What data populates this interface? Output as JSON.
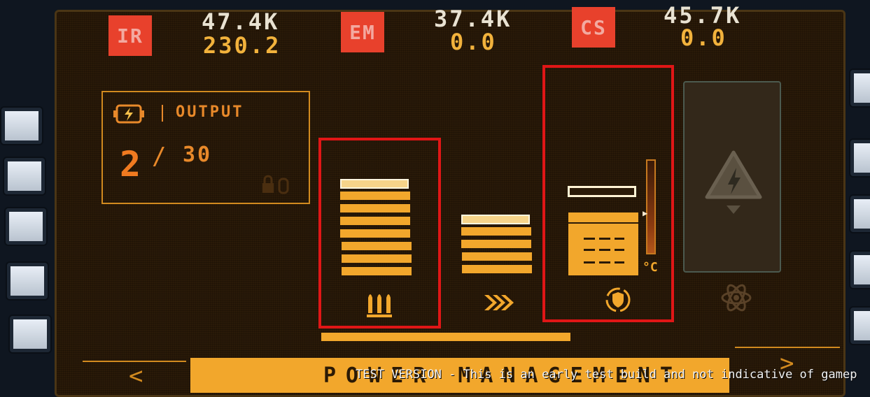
{
  "signatures": [
    {
      "badge": "IR",
      "value_top": "47.4K",
      "value_bottom": "230.2"
    },
    {
      "badge": "EM",
      "value_top": "37.4K",
      "value_bottom": "0.0"
    },
    {
      "badge": "CS",
      "value_top": "45.7K",
      "value_bottom": "0.0"
    }
  ],
  "output": {
    "label": "OUTPUT",
    "current": "2",
    "separator": "/",
    "max": "30"
  },
  "temperature": {
    "unit": "°C"
  },
  "footer": {
    "title": "POWER MANAGEMENT",
    "prev_arrow": "<",
    "next_arrow": ">"
  },
  "banner": "TEST VERSION - This is an early test build and not indicative of gamep",
  "colors": {
    "accent": "#f2a72c",
    "badge": "#e8412c",
    "highlight": "#e01616",
    "background": "#2a1a08"
  },
  "icons": [
    "power-cell-icon",
    "lock-icon",
    "ammo-icon",
    "chevron-forward-icon",
    "shield-icon",
    "warning-power-icon",
    "atom-icon"
  ]
}
